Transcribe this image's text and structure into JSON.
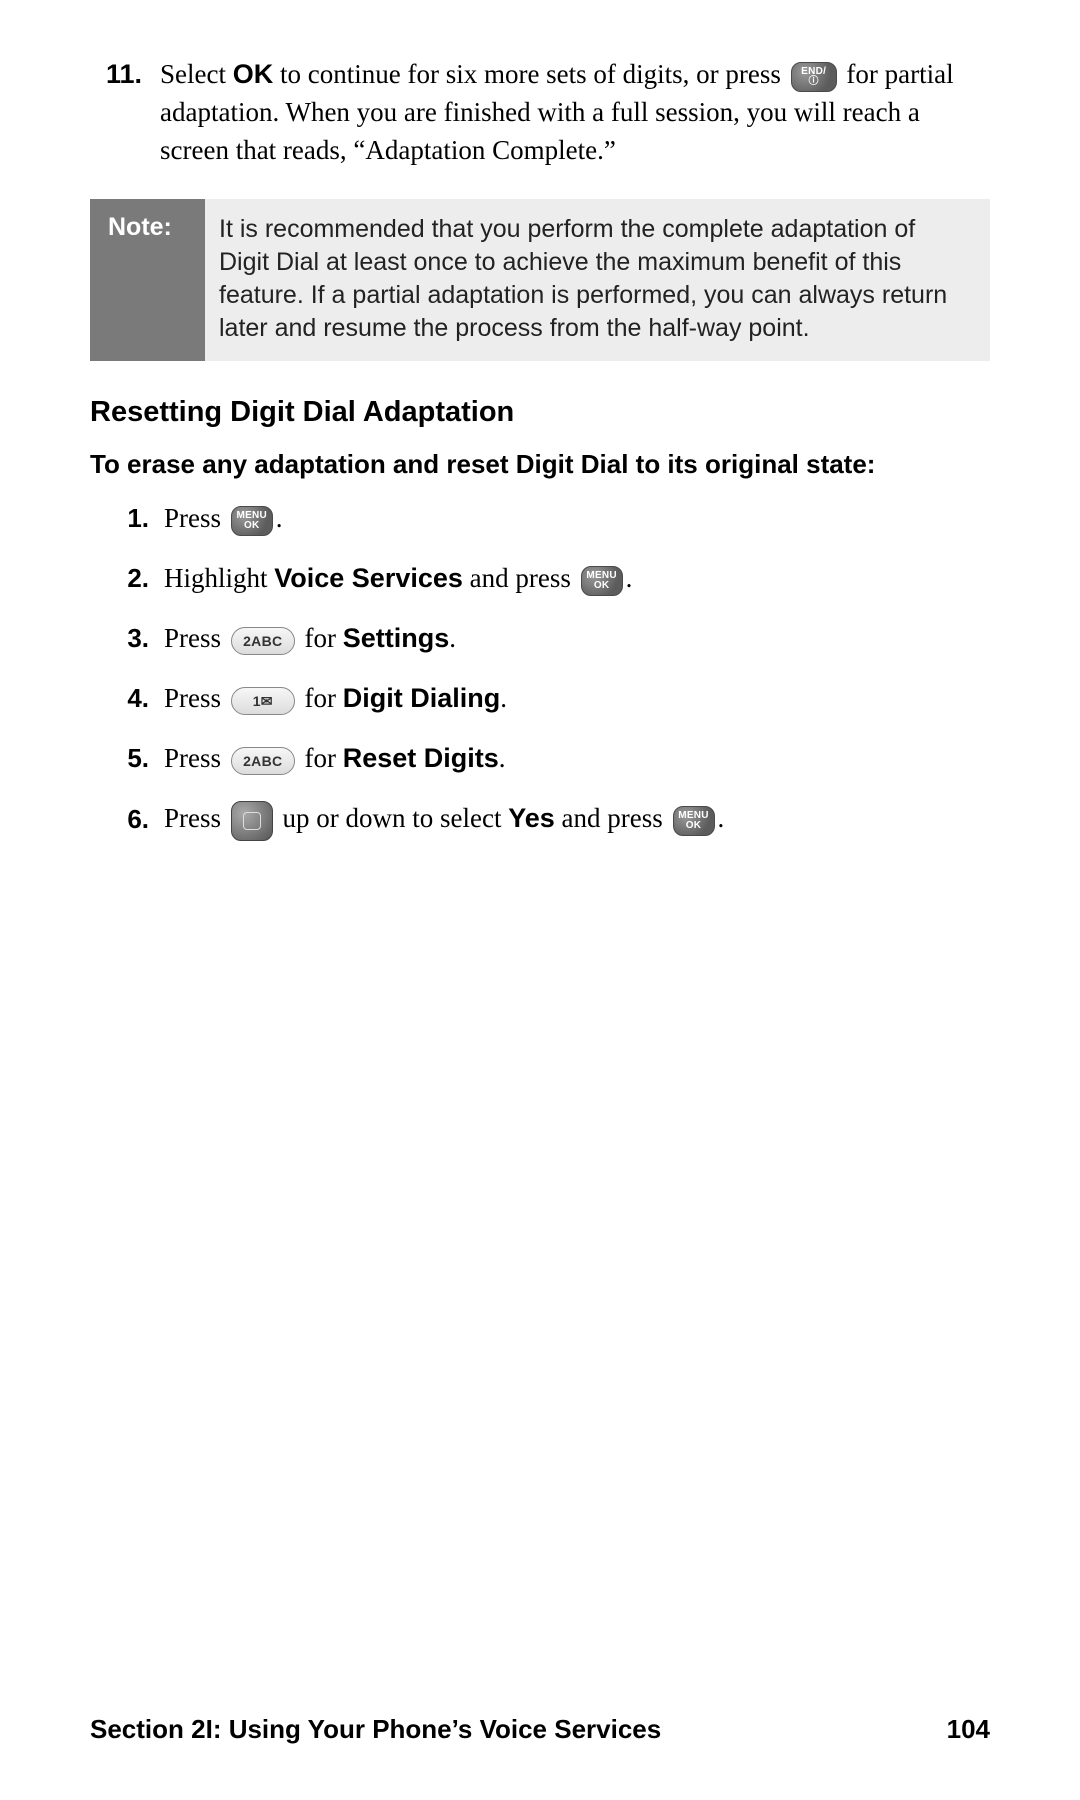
{
  "step11": {
    "num": "11.",
    "t1": "Select ",
    "ok": "OK",
    "t2": " to continue for six more sets of digits, or press ",
    "icon_end": "END/ⓘ",
    "t3": " for partial adaptation. When you are finished with a full session, you will reach a screen that reads, “Adaptation Complete.”"
  },
  "note": {
    "label": "Note:",
    "body": "It is recommended that you perform the complete adaptation of Digit Dial at least once to achieve the maximum benefit of this feature. If a partial adaptation is performed, you can always return later and resume the process from the half-way point."
  },
  "heading": "Resetting Digit Dial Adaptation",
  "intro": "To erase any adaptation and reset Digit Dial to its original state:",
  "icons": {
    "menu_ok": "MENU\nOK",
    "key2": "2ABC",
    "key1": "1✉",
    "nav": ""
  },
  "steps": [
    {
      "n": "1.",
      "a": "Press ",
      "icon": "menu_ok",
      "b": "."
    },
    {
      "n": "2.",
      "a": "Highlight ",
      "bold": "Voice Services",
      "b": " and press ",
      "icon": "menu_ok",
      "c": "."
    },
    {
      "n": "3.",
      "a": "Press ",
      "icon": "key2",
      "b": " for ",
      "bold": "Settings",
      "c": "."
    },
    {
      "n": "4.",
      "a": "Press ",
      "icon": "key1",
      "b": " for ",
      "bold": "Digit Dialing",
      "c": "."
    },
    {
      "n": "5.",
      "a": "Press ",
      "icon": "key2",
      "b": " for ",
      "bold": "Reset Digits",
      "c": "."
    },
    {
      "n": "6.",
      "a": "Press ",
      "icon": "nav",
      "b": " up or down to select ",
      "bold": "Yes",
      "c": " and press ",
      "icon2": "menu_ok",
      "d": "."
    }
  ],
  "footer": {
    "left": "Section 2I: Using Your Phone’s Voice Services",
    "right": "104"
  }
}
